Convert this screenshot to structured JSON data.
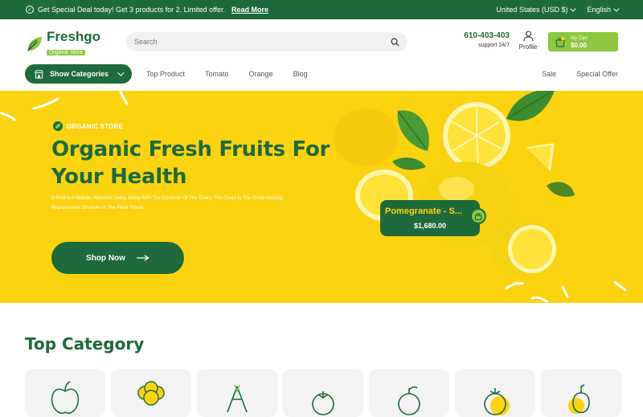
{
  "topbar": {
    "deal_text": "Get Special Deal today! Get 3 products for 2. Limited offer.",
    "deal_link": "Read More",
    "currency": "United States (USD $)",
    "language": "English"
  },
  "header": {
    "brand": "Freshgo",
    "brand_tag": "Organic store",
    "search_placeholder": "Search",
    "phone": "610-403-403",
    "support": "support 24/7",
    "profile_label": "Profile",
    "cart_label": "My Cart",
    "cart_amount": "$0.00"
  },
  "nav": {
    "categories_button": "Show Categories",
    "links": [
      "Top Product",
      "Tomato",
      "Orange",
      "Blog"
    ],
    "right_links": [
      "Sale",
      "Special Offer"
    ]
  },
  "hero": {
    "eyebrow": "ORGANIC STORE",
    "title_line1": "Organic Fresh Fruits For",
    "title_line2": "Your Health",
    "desc_line1": "A Fruit Is A Mature, Ripened Ovary, Along With The Contents Of The Ovary. The Ovary Is The Ovule-bearing",
    "desc_line2": "Reproductive Structure In The Plant Flower.",
    "cta": "Shop Now",
    "product_name": "Pomegranate - S...",
    "product_price": "$1,680.00"
  },
  "sections": {
    "top_category": "Top Category"
  },
  "colors": {
    "primary": "#1e6a3b",
    "accent": "#8dc63f",
    "hero_bg": "#fcd311"
  }
}
